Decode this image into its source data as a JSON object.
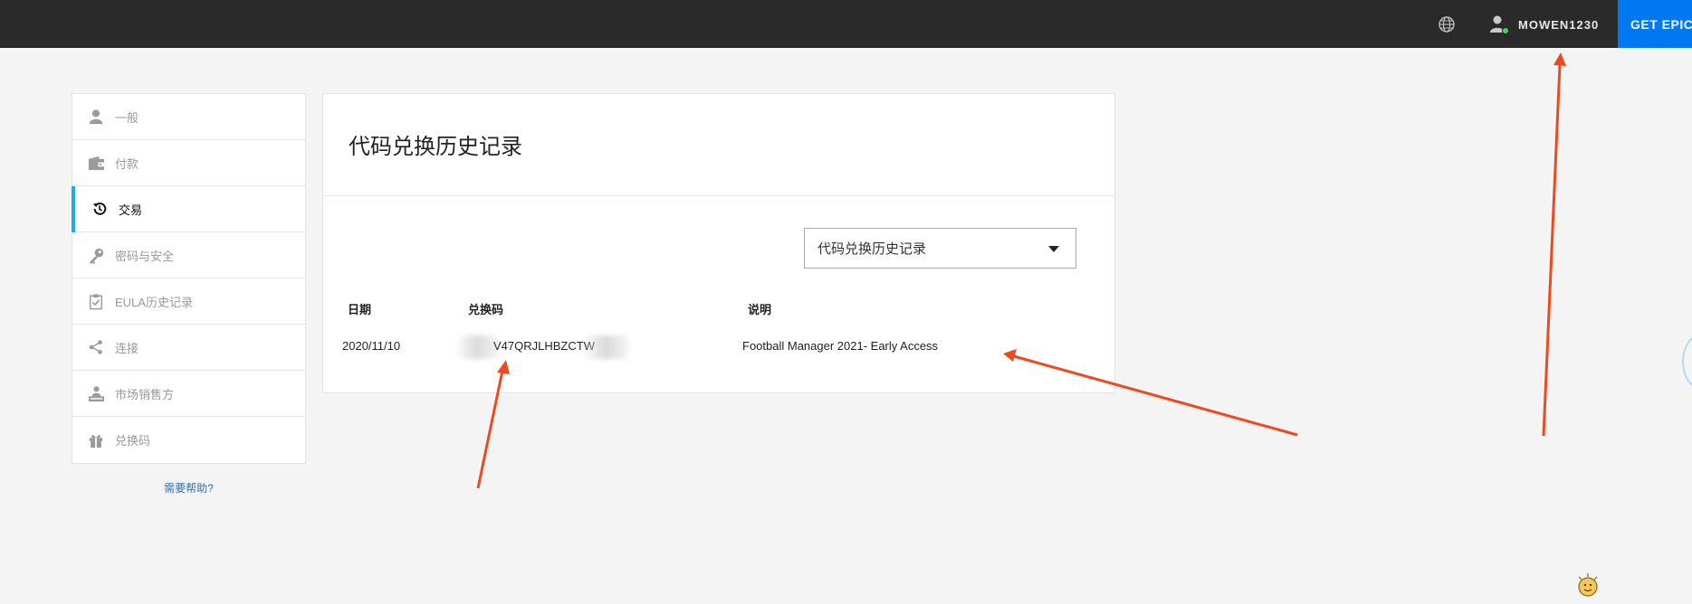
{
  "topbar": {
    "globe_icon": "globe-icon",
    "username": "MOWEN1230",
    "get_epic_label": "GET EPIC G",
    "accent": "#0078f2"
  },
  "sidebar": {
    "items": [
      {
        "label": "一般",
        "icon": "person-icon",
        "active": false
      },
      {
        "label": "付款",
        "icon": "wallet-icon",
        "active": false
      },
      {
        "label": "交易",
        "icon": "history-icon",
        "active": true
      },
      {
        "label": "密码与安全",
        "icon": "key-icon",
        "active": false
      },
      {
        "label": "EULA历史记录",
        "icon": "clipboard-check-icon",
        "active": false
      },
      {
        "label": "连接",
        "icon": "share-icon",
        "active": false
      },
      {
        "label": "市场销售方",
        "icon": "vendor-icon",
        "active": false
      },
      {
        "label": "兑换码",
        "icon": "gift-icon",
        "active": false
      }
    ],
    "active_color": "#1eaee4",
    "help_link": "需要帮助?"
  },
  "main": {
    "title": "代码兑换历史记录",
    "filter_select": {
      "value": "代码兑换历史记录"
    },
    "table": {
      "headers": [
        "日期",
        "兑换码",
        "说明"
      ],
      "rows": [
        {
          "date": "2020/11/10",
          "code_visible": "V47QRJLHBZCTW",
          "description": "Football Manager 2021- Early Access"
        }
      ]
    }
  },
  "annotation_color": "#ee4a1f"
}
